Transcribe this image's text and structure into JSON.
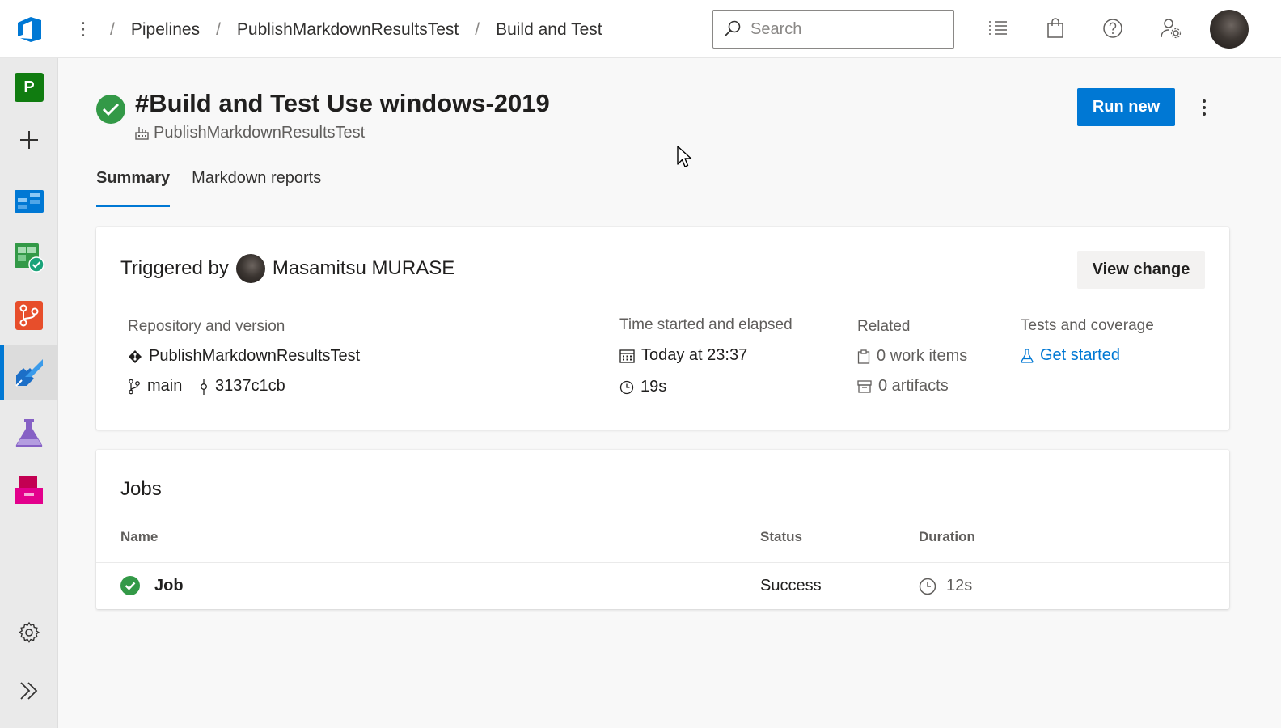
{
  "topbar": {
    "breadcrumbs": [
      "Pipelines",
      "PublishMarkdownResultsTest",
      "Build and Test"
    ],
    "search_placeholder": "Search",
    "icons": [
      "task-list-icon",
      "shopping-bag-icon",
      "help-icon",
      "user-settings-icon"
    ]
  },
  "rail": {
    "project_initial": "P",
    "items": [
      "new-icon",
      "boards-icon",
      "test-plans-board-icon",
      "repos-icon",
      "pipelines-icon",
      "test-plans-icon",
      "artifacts-icon",
      "settings-icon",
      "expand-icon"
    ],
    "active": "pipelines-icon"
  },
  "run": {
    "title": "#Build and Test Use windows-2019",
    "pipeline": "PublishMarkdownResultsTest",
    "status": "succeeded",
    "run_new_label": "Run new"
  },
  "tabs": [
    {
      "label": "Summary",
      "active": true
    },
    {
      "label": "Markdown reports",
      "active": false
    }
  ],
  "summary": {
    "triggered_by_label": "Triggered by",
    "triggered_by_user": "Masamitsu MURASE",
    "view_change_label": "View change",
    "repo": {
      "label": "Repository and version",
      "name": "PublishMarkdownResultsTest",
      "branch": "main",
      "commit": "3137c1cb"
    },
    "time": {
      "label": "Time started and elapsed",
      "started": "Today at 23:37",
      "elapsed": "19s"
    },
    "related": {
      "label": "Related",
      "work_items": "0 work items",
      "artifacts": "0 artifacts"
    },
    "tests": {
      "label": "Tests and coverage",
      "link": "Get started"
    }
  },
  "jobs": {
    "title": "Jobs",
    "columns": [
      "Name",
      "Status",
      "Duration"
    ],
    "rows": [
      {
        "name": "Job",
        "status": "Success",
        "duration": "12s"
      }
    ]
  },
  "colors": {
    "accent": "#0078d4",
    "success": "#339947",
    "project_badge": "#107c10"
  }
}
